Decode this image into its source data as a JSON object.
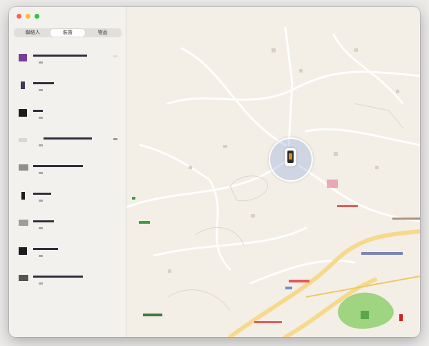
{
  "window": {
    "traffic_lights": [
      "close",
      "minimize",
      "zoom"
    ]
  },
  "segmented_control": {
    "tabs": [
      {
        "label": "聯絡人",
        "active": false
      },
      {
        "label": "裝置",
        "active": true
      },
      {
        "label": "物品",
        "active": false
      }
    ]
  },
  "devices": [
    {
      "name": "",
      "subtitle": "",
      "icon": "device-icon"
    },
    {
      "name": "",
      "subtitle": "",
      "icon": "device-icon"
    },
    {
      "name": "",
      "subtitle": "",
      "icon": "device-icon"
    },
    {
      "name": "",
      "subtitle": "",
      "icon": "device-icon"
    },
    {
      "name": "",
      "subtitle": "",
      "icon": "device-icon"
    },
    {
      "name": "",
      "subtitle": "",
      "icon": "device-icon"
    },
    {
      "name": "",
      "subtitle": "",
      "icon": "device-icon"
    },
    {
      "name": "",
      "subtitle": "",
      "icon": "device-icon"
    },
    {
      "name": "",
      "subtitle": "",
      "icon": "device-icon"
    }
  ],
  "map": {
    "selected_device_pin": "phone-icon",
    "colors": {
      "background": "#f3eee6",
      "road": "#ffffff",
      "highway": "#f6d98a",
      "park": "#8fcf6e",
      "pin_halo": "#a7b8e6"
    }
  }
}
